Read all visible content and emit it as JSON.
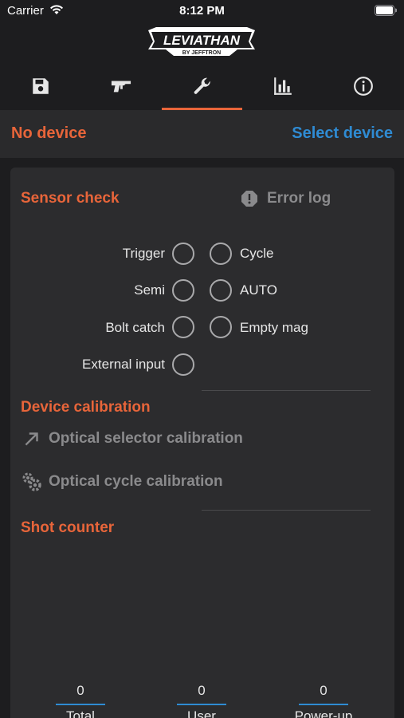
{
  "status_bar": {
    "carrier": "Carrier",
    "time": "8:12 PM"
  },
  "logo": {
    "title": "LEVIATHAN",
    "subtitle": "BY JEFFTRON"
  },
  "tabs": [
    {
      "name": "save",
      "icon": "floppy-disk-icon",
      "active": false
    },
    {
      "name": "gun",
      "icon": "gun-icon",
      "active": false
    },
    {
      "name": "wrench",
      "icon": "wrench-icon",
      "active": true
    },
    {
      "name": "stats",
      "icon": "bar-chart-icon",
      "active": false
    },
    {
      "name": "info",
      "icon": "info-icon",
      "active": false
    }
  ],
  "device": {
    "status": "No device",
    "action": "Select device"
  },
  "sensor_check": {
    "title": "Sensor check",
    "error_log": "Error log",
    "sensors": {
      "trigger": "Trigger",
      "cycle": "Cycle",
      "semi": "Semi",
      "auto": "AUTO",
      "bolt_catch": "Bolt catch",
      "empty_mag": "Empty mag",
      "external_input": "External input"
    }
  },
  "calibration": {
    "title": "Device calibration",
    "optical_selector": "Optical selector calibration",
    "optical_cycle": "Optical cycle calibration"
  },
  "shot_counter": {
    "title": "Shot counter",
    "counters": [
      {
        "value": "0",
        "label": "Total"
      },
      {
        "value": "0",
        "label": "User"
      },
      {
        "value": "0",
        "label": "Power-up"
      }
    ]
  },
  "colors": {
    "accent": "#e8653a",
    "link": "#2f8bd3",
    "background": "#1d1d1f",
    "card": "#2c2c2e"
  }
}
